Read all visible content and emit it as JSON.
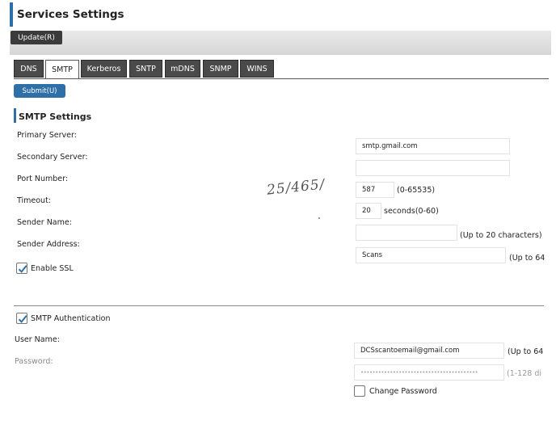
{
  "page": {
    "title": "Services Settings"
  },
  "toolbar": {
    "update_label": "Update(R)"
  },
  "tabs": [
    {
      "label": "DNS"
    },
    {
      "label": "SMTP",
      "active": true
    },
    {
      "label": "Kerberos"
    },
    {
      "label": "SNTP"
    },
    {
      "label": "mDNS"
    },
    {
      "label": "SNMP"
    },
    {
      "label": "WINS"
    }
  ],
  "submit_label": "Submit(U)",
  "smtp": {
    "section_title": "SMTP Settings",
    "primary_server": {
      "label": "Primary Server:",
      "value": "smtp.gmail.com"
    },
    "secondary_server": {
      "label": "Secondary Server:",
      "value": ""
    },
    "port_number": {
      "label": "Port Number:",
      "value": "587",
      "hint": "(0-65535)"
    },
    "timeout": {
      "label": "Timeout:",
      "value": "20",
      "hint": "seconds(0-60)"
    },
    "sender_name": {
      "label": "Sender Name:",
      "value": "",
      "hint": "(Up to 20 characters)"
    },
    "sender_address": {
      "label": "Sender Address:",
      "value": "Scans",
      "hint": "(Up to 64"
    },
    "enable_ssl": {
      "label": "Enable SSL",
      "checked": true
    }
  },
  "auth": {
    "smtp_authentication": {
      "label": "SMTP Authentication",
      "checked": true
    },
    "user_name": {
      "label": "User Name:",
      "value": "DCSscantoemail@gmail.com",
      "hint": "(Up to 64"
    },
    "password": {
      "label": "Password:",
      "value": "••••••••••••••••••••••••••••••••••••••••",
      "hint": "(1-128 di"
    },
    "change_password": {
      "label": "Change Password",
      "checked": false
    }
  },
  "annotation": {
    "handwritten_note": "25/465/"
  },
  "colors": {
    "accent": "#2f6fa8",
    "tab_bg": "#4a4a4a",
    "button_dark": "#3b3b3b"
  }
}
